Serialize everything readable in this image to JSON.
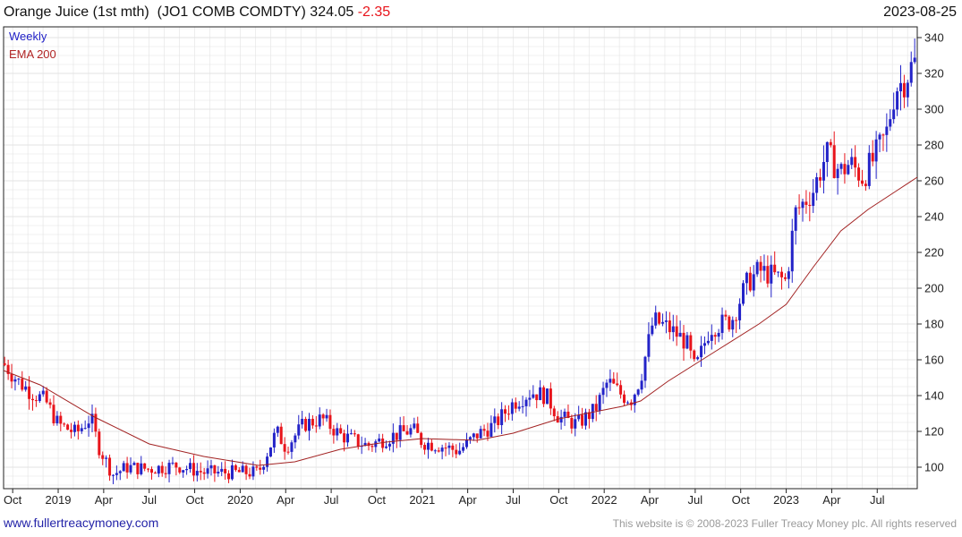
{
  "header": {
    "name": "Orange Juice (1st mth)",
    "ticker": "(JO1 COMB COMDTY)",
    "price": "324.05",
    "change": "-2.35",
    "date": "2023-08-25"
  },
  "footer": {
    "website": "www.fullertreacymoney.com",
    "copyright": "This website is © 2008-2023 Fuller Treacy Money plc. All rights reserved"
  },
  "chart_data": {
    "type": "candlestick",
    "legend": [
      "Weekly",
      "EMA 200"
    ],
    "legend_position": "top-left",
    "colors": {
      "up": "#2323c8",
      "down": "#e8141b",
      "ema": "#a22222",
      "grid": "#e3e3e3"
    },
    "ylim": [
      88,
      346
    ],
    "yticks": [
      100,
      120,
      140,
      160,
      180,
      200,
      220,
      240,
      260,
      280,
      300,
      320,
      340
    ],
    "xrange": [
      2018.7,
      2023.72
    ],
    "xticks": [
      {
        "label": "Oct",
        "x": 2018.75
      },
      {
        "label": "2019",
        "x": 2019.0
      },
      {
        "label": "Apr",
        "x": 2019.25
      },
      {
        "label": "Jul",
        "x": 2019.5
      },
      {
        "label": "Oct",
        "x": 2019.75
      },
      {
        "label": "2020",
        "x": 2020.0
      },
      {
        "label": "Apr",
        "x": 2020.25
      },
      {
        "label": "Jul",
        "x": 2020.5
      },
      {
        "label": "Oct",
        "x": 2020.75
      },
      {
        "label": "2021",
        "x": 2021.0
      },
      {
        "label": "Apr",
        "x": 2021.25
      },
      {
        "label": "Jul",
        "x": 2021.5
      },
      {
        "label": "Oct",
        "x": 2021.75
      },
      {
        "label": "2022",
        "x": 2022.0
      },
      {
        "label": "Apr",
        "x": 2022.25
      },
      {
        "label": "Jul",
        "x": 2022.5
      },
      {
        "label": "Oct",
        "x": 2022.75
      },
      {
        "label": "2023",
        "x": 2023.0
      },
      {
        "label": "Apr",
        "x": 2023.25
      },
      {
        "label": "Jul",
        "x": 2023.5
      }
    ],
    "grid": true,
    "price_path": [
      [
        2018.7,
        158
      ],
      [
        2018.78,
        148
      ],
      [
        2018.85,
        142
      ],
      [
        2018.93,
        137
      ],
      [
        2019.0,
        124
      ],
      [
        2019.1,
        119
      ],
      [
        2019.18,
        128
      ],
      [
        2019.22,
        112
      ],
      [
        2019.3,
        96
      ],
      [
        2019.38,
        100
      ],
      [
        2019.5,
        99
      ],
      [
        2019.65,
        101
      ],
      [
        2019.8,
        97
      ],
      [
        2019.95,
        97
      ],
      [
        2020.1,
        97
      ],
      [
        2020.2,
        120
      ],
      [
        2020.25,
        111
      ],
      [
        2020.35,
        124
      ],
      [
        2020.45,
        127
      ],
      [
        2020.55,
        118
      ],
      [
        2020.7,
        112
      ],
      [
        2020.85,
        118
      ],
      [
        2020.95,
        121
      ],
      [
        2021.0,
        114
      ],
      [
        2021.1,
        112
      ],
      [
        2021.2,
        109
      ],
      [
        2021.3,
        118
      ],
      [
        2021.4,
        124
      ],
      [
        2021.5,
        136
      ],
      [
        2021.6,
        142
      ],
      [
        2021.68,
        140
      ],
      [
        2021.75,
        128
      ],
      [
        2021.85,
        124
      ],
      [
        2021.95,
        132
      ],
      [
        2022.02,
        148
      ],
      [
        2022.1,
        140
      ],
      [
        2022.15,
        138
      ],
      [
        2022.2,
        150
      ],
      [
        2022.27,
        182
      ],
      [
        2022.35,
        178
      ],
      [
        2022.45,
        170
      ],
      [
        2022.5,
        154
      ],
      [
        2022.58,
        178
      ],
      [
        2022.7,
        182
      ],
      [
        2022.78,
        202
      ],
      [
        2022.85,
        210
      ],
      [
        2022.95,
        206
      ],
      [
        2023.0,
        204
      ],
      [
        2023.05,
        242
      ],
      [
        2023.15,
        255
      ],
      [
        2023.22,
        275
      ],
      [
        2023.3,
        265
      ],
      [
        2023.35,
        270
      ],
      [
        2023.42,
        262
      ],
      [
        2023.48,
        272
      ],
      [
        2023.55,
        286
      ],
      [
        2023.6,
        312
      ],
      [
        2023.65,
        316
      ],
      [
        2023.7,
        326
      ]
    ],
    "ema_path": [
      [
        2018.7,
        154
      ],
      [
        2018.9,
        146
      ],
      [
        2019.2,
        128
      ],
      [
        2019.5,
        113
      ],
      [
        2019.8,
        106
      ],
      [
        2020.1,
        101
      ],
      [
        2020.3,
        103
      ],
      [
        2020.55,
        110
      ],
      [
        2020.8,
        114
      ],
      [
        2021.0,
        116
      ],
      [
        2021.3,
        115
      ],
      [
        2021.5,
        119
      ],
      [
        2021.75,
        127
      ],
      [
        2021.95,
        131
      ],
      [
        2022.1,
        134
      ],
      [
        2022.2,
        137
      ],
      [
        2022.35,
        148
      ],
      [
        2022.6,
        164
      ],
      [
        2022.85,
        180
      ],
      [
        2023.0,
        191
      ],
      [
        2023.15,
        212
      ],
      [
        2023.3,
        232
      ],
      [
        2023.45,
        244
      ],
      [
        2023.6,
        254
      ],
      [
        2023.72,
        262
      ]
    ]
  }
}
